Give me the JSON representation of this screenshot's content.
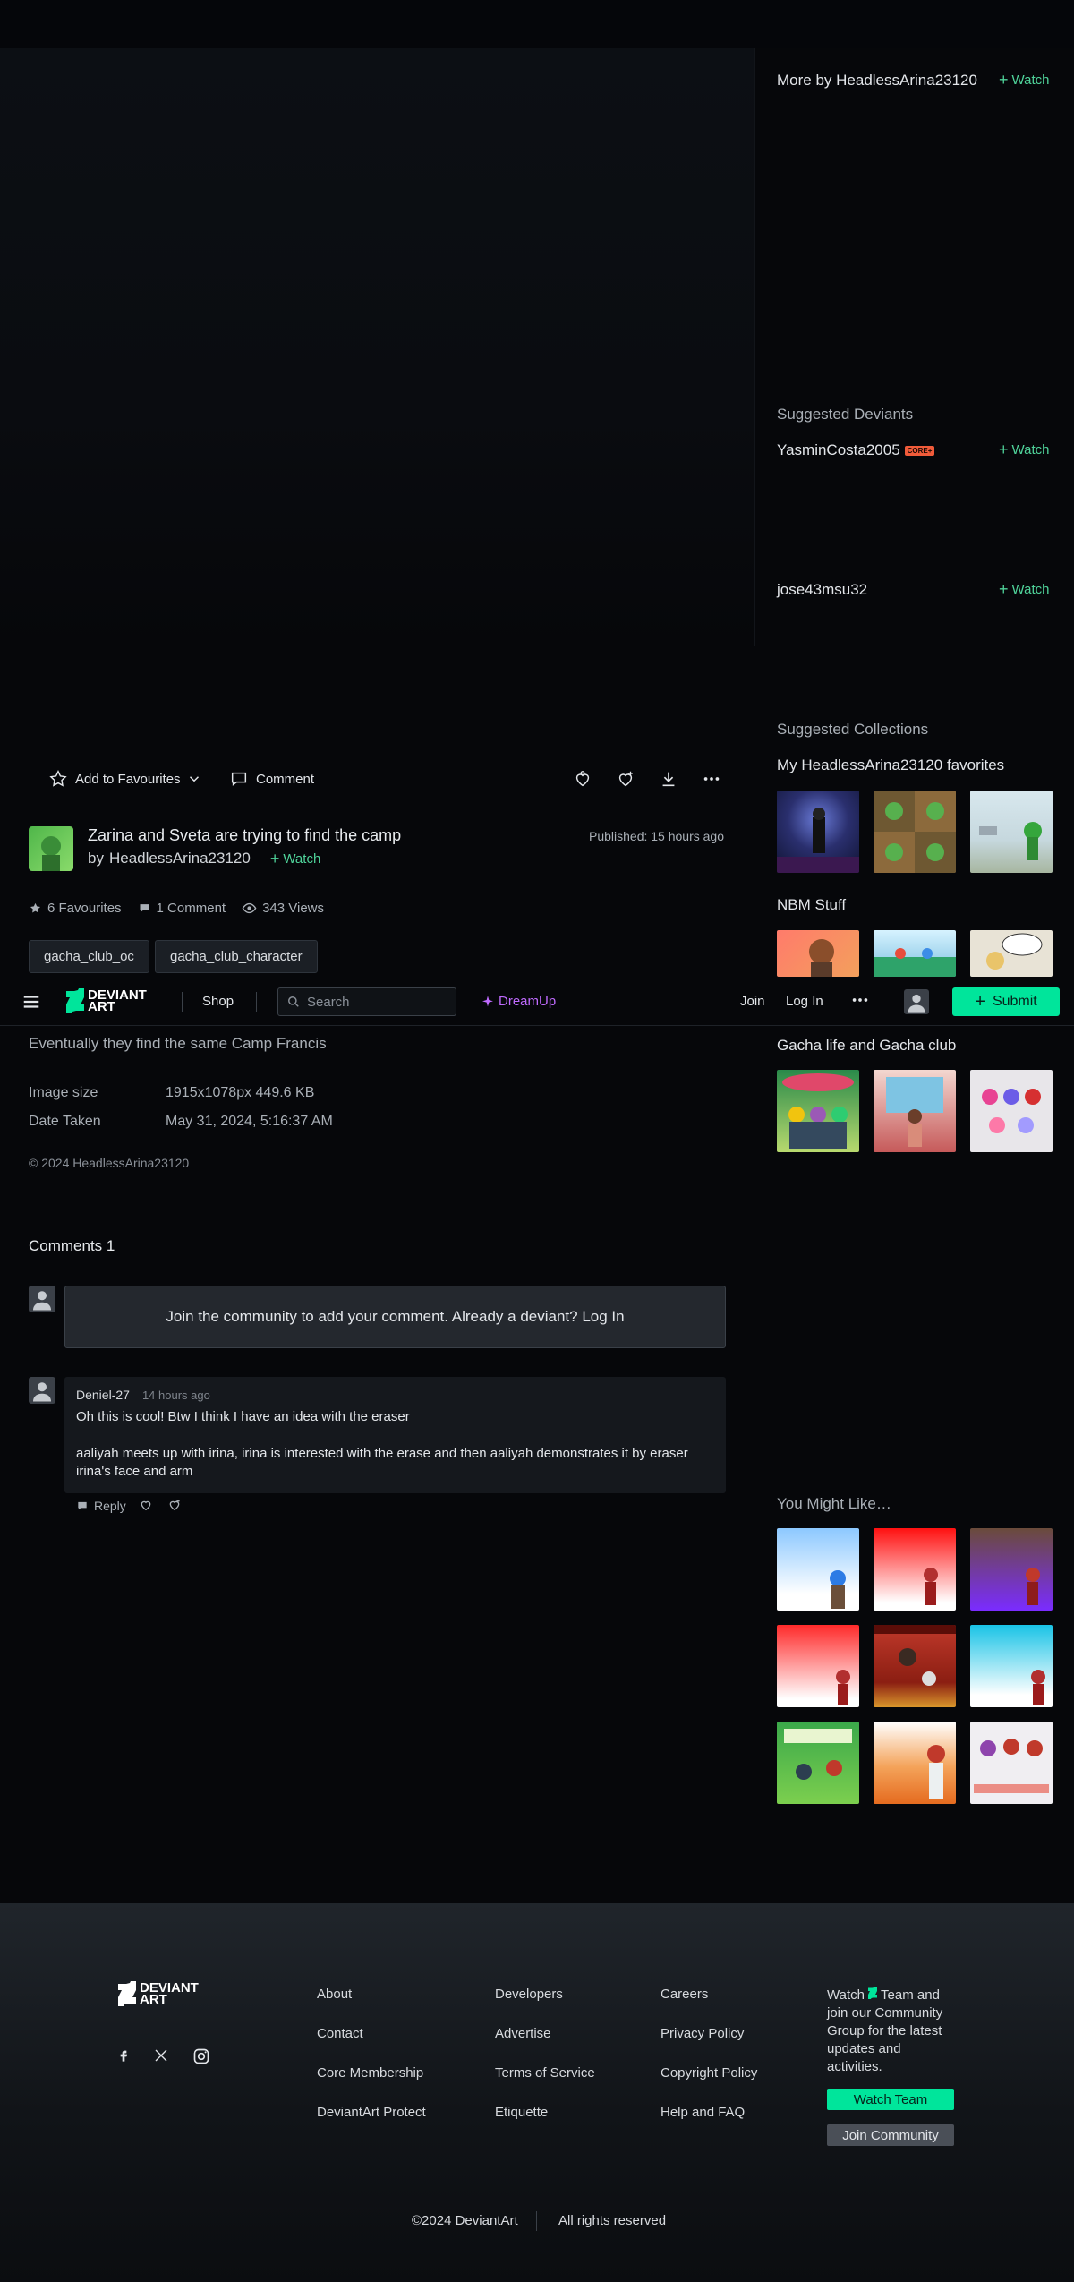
{
  "sidebar": {
    "more_by": "More by HeadlessArina23120",
    "watch_label": "Watch",
    "suggested_deviants_heading": "Suggested Deviants",
    "deviant1": "YasminCosta2005",
    "core_badge": "CORE+",
    "deviant2": "jose43msu32",
    "suggested_collections_heading": "Suggested Collections",
    "collection1": "My HeadlessArina23120 favorites",
    "collection2": "NBM Stuff",
    "collection3": "Gacha life and Gacha club",
    "you_might_like": "You Might Like…"
  },
  "actions": {
    "add_fav": "Add to Favourites",
    "comment": "Comment"
  },
  "deviation": {
    "title": "Zarina and Sveta are trying to find the camp",
    "by_prefix": "by",
    "author": "HeadlessArina23120",
    "published": "Published: 15 hours ago",
    "favourites": "6 Favourites",
    "comments": "1 Comment",
    "views": "343 Views",
    "tags": [
      "gacha_club_oc",
      "gacha_club_character"
    ],
    "description": "Eventually they find the same Camp Francis",
    "image_size_label": "Image size",
    "image_size_value": "1915x1078px 449.6 KB",
    "date_label": "Date Taken",
    "date_value": "May 31, 2024, 5:16:37 AM",
    "copyright": "© 2024 HeadlessArina23120"
  },
  "nav": {
    "logo_text": "DEVIANT ART",
    "shop": "Shop",
    "search_placeholder": "Search",
    "dreamup": "DreamUp",
    "join": "Join",
    "login": "Log In",
    "submit": "Submit"
  },
  "comments_section": {
    "title": "Comments 1",
    "join_prompt": "Join the community to add your comment. Already a deviant? Log In",
    "comment": {
      "author": "Deniel-27",
      "time": "14 hours ago",
      "line1": "Oh this is cool! Btw I think I have an idea with the eraser",
      "line2": "aaliyah meets up with irina, irina is interested with the erase and then aaliyah demonstrates it by eraser irina's face and arm",
      "reply": "Reply"
    }
  },
  "footer": {
    "logo_text": "DEVIANT ART",
    "col1": [
      "About",
      "Contact",
      "Core Membership",
      "DeviantArt Protect"
    ],
    "col2": [
      "Developers",
      "Advertise",
      "Terms of Service",
      "Etiquette"
    ],
    "col3": [
      "Careers",
      "Privacy Policy",
      "Copyright Policy",
      "Help and FAQ"
    ],
    "watch_team_text_a": "Watch",
    "watch_team_text_b": "Team and join our Community Group for the latest updates and activities.",
    "watch_team_btn": "Watch Team",
    "join_community_btn": "Join Community",
    "copyright": "©2024 DeviantArt",
    "rights": "All rights reserved"
  },
  "colors": {
    "accent_green": "#00e59b",
    "watch_green": "#4fd39a",
    "dreamup_purple": "#c06bff",
    "background": "#06070a"
  }
}
